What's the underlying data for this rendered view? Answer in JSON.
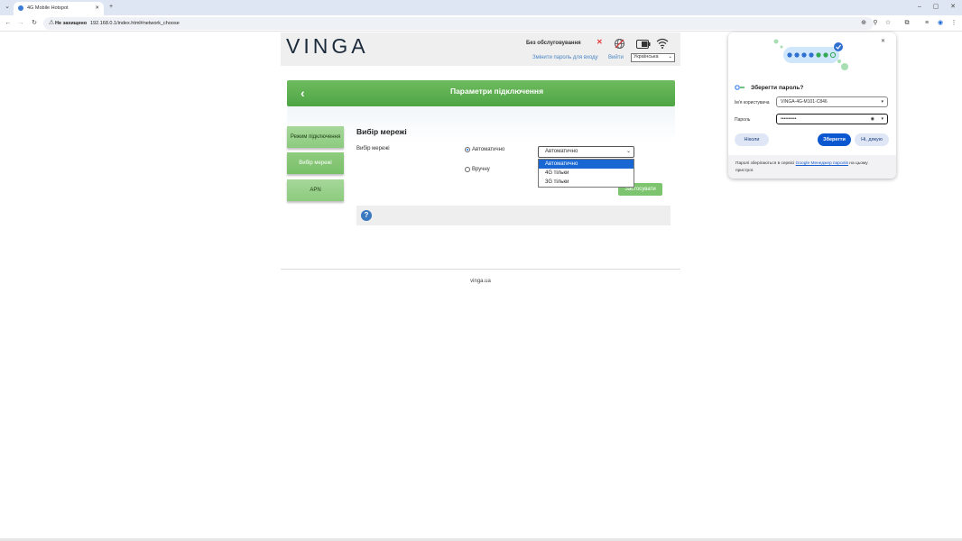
{
  "browser": {
    "tab_title": "4G Mobile Hotspot",
    "tab_close": "✕",
    "new_tab": "+",
    "security_label": "Не захищено",
    "url": "192.168.0.1/index.html#network_choose",
    "window_controls": [
      "–",
      "▢",
      "✕"
    ]
  },
  "header": {
    "logo": "VINGA",
    "status": "Без обслуговування",
    "change_password_link": "Змінити пароль для входу",
    "logout_link": "Вийти",
    "language": "Українська"
  },
  "banner": {
    "title": "Параметри підключення"
  },
  "sidebar": {
    "items": [
      {
        "label": "Режим підключення"
      },
      {
        "label": "Вибір мережі"
      },
      {
        "label": "APN"
      }
    ]
  },
  "main": {
    "section_title": "Вибір мережі",
    "field_label": "Вибір мережі",
    "radio_auto": "Автоматично",
    "radio_manual": "Вручну",
    "select_value": "Автоматично",
    "options": [
      "Автоматично",
      "4G тільки",
      "3G тільки"
    ],
    "apply_button": "Застосувати",
    "help_icon": "?"
  },
  "footer": {
    "text": "vinga.ua"
  },
  "password_popup": {
    "title": "Зберегти пароль?",
    "username_label": "Ім'я користувача",
    "username_value": "VINGA-4G-M101-C846",
    "password_label": "Пароль",
    "password_value": "••••••••••",
    "never_button": "Ніколи",
    "save_button": "Зберегти",
    "no_thanks_button": "Ні, дякую",
    "note_prefix": "Паролі зберігаються в сервісі ",
    "note_link": "Google Менеджер паролів",
    "note_suffix": " на цьому",
    "note_line2": "пристрої.",
    "close": "✕"
  },
  "colors": {
    "green_banner": "#5aae4e",
    "green_button": "#8ccb7e",
    "chrome_blue": "#1967d2",
    "popup_save": "#0b57d0"
  }
}
